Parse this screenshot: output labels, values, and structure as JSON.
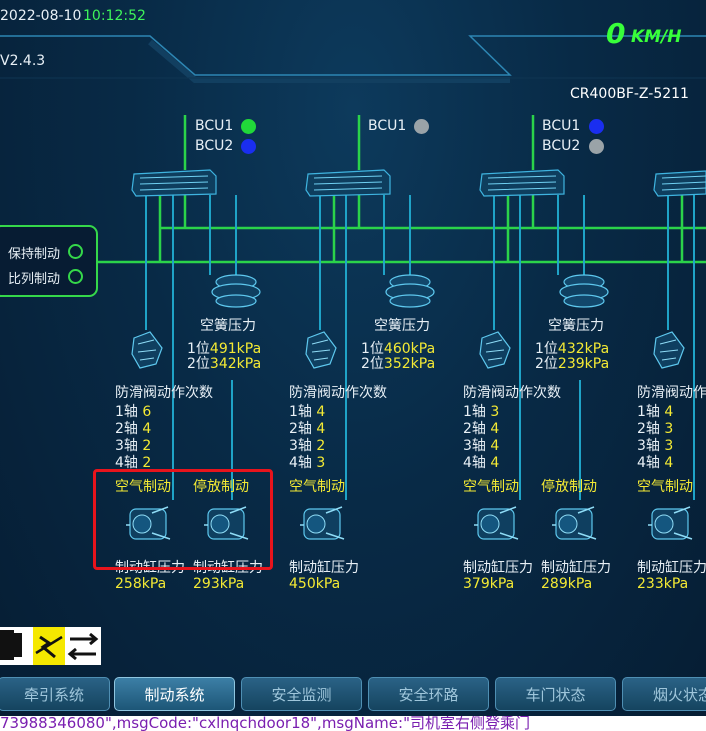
{
  "header": {
    "date": "2022-08-10",
    "time": "10:12:52",
    "version": "V2.4.3",
    "speed": "0",
    "speed_unit": "KM/H",
    "train_id": "CR400BF-Z-5211"
  },
  "hold_panel": {
    "items": [
      {
        "label": "保持制动"
      },
      {
        "label": "比列制动"
      }
    ]
  },
  "cars": [
    {
      "bcu": [
        {
          "label": "BCU1",
          "color": "#21d83a"
        },
        {
          "label": "BCU2",
          "color": "#1a2ef0"
        }
      ],
      "air_spring": {
        "title": "空簧压力",
        "p1_label": "1位",
        "p1": "491kPa",
        "p2_label": "2位",
        "p2": "342kPa"
      },
      "antiskid": {
        "title": "防滑阀动作次数",
        "axles": [
          {
            "label": "1轴",
            "val": "6"
          },
          {
            "label": "2轴",
            "val": "4"
          },
          {
            "label": "3轴",
            "val": "2"
          },
          {
            "label": "4轴",
            "val": "2"
          }
        ]
      },
      "brakes": [
        {
          "label": "空气制动",
          "cyl_label": "制动缸压力",
          "cyl": "258kPa"
        },
        {
          "label": "停放制动",
          "cyl_label": "制动缸压力",
          "cyl": "293kPa"
        }
      ]
    },
    {
      "bcu": [
        {
          "label": "BCU1",
          "color": "#9aa3a8"
        }
      ],
      "air_spring": {
        "title": "空簧压力",
        "p1_label": "1位",
        "p1": "460kPa",
        "p2_label": "2位",
        "p2": "352kPa"
      },
      "antiskid": {
        "title": "防滑阀动作次数",
        "axles": [
          {
            "label": "1轴",
            "val": "4"
          },
          {
            "label": "2轴",
            "val": "4"
          },
          {
            "label": "3轴",
            "val": "2"
          },
          {
            "label": "4轴",
            "val": "3"
          }
        ]
      },
      "brakes": [
        {
          "label": "空气制动",
          "cyl_label": "制动缸压力",
          "cyl": "450kPa"
        }
      ]
    },
    {
      "bcu": [
        {
          "label": "BCU1",
          "color": "#1a2ef0"
        },
        {
          "label": "BCU2",
          "color": "#9aa3a8"
        }
      ],
      "air_spring": {
        "title": "空簧压力",
        "p1_label": "1位",
        "p1": "432kPa",
        "p2_label": "2位",
        "p2": "239kPa"
      },
      "antiskid": {
        "title": "防滑阀动作次数",
        "axles": [
          {
            "label": "1轴",
            "val": "3"
          },
          {
            "label": "2轴",
            "val": "4"
          },
          {
            "label": "3轴",
            "val": "4"
          },
          {
            "label": "4轴",
            "val": "4"
          }
        ]
      },
      "brakes": [
        {
          "label": "空气制动",
          "cyl_label": "制动缸压力",
          "cyl": "379kPa"
        },
        {
          "label": "停放制动",
          "cyl_label": "制动缸压力",
          "cyl": "289kPa"
        }
      ]
    },
    {
      "antiskid": {
        "title": "防滑阀动作次数",
        "axles": [
          {
            "label": "1轴",
            "val": "4"
          },
          {
            "label": "2轴",
            "val": "3"
          },
          {
            "label": "3轴",
            "val": "3"
          },
          {
            "label": "4轴",
            "val": "4"
          }
        ]
      },
      "brakes": [
        {
          "label": "空气制动",
          "cyl_label": "制动缸压力",
          "cyl": "233kPa"
        }
      ]
    }
  ],
  "nav": [
    {
      "label": "牵引系统"
    },
    {
      "label": "制动系统"
    },
    {
      "label": "安全监测"
    },
    {
      "label": "安全环路"
    },
    {
      "label": "车门状态"
    },
    {
      "label": "烟火状态"
    }
  ],
  "icons": [
    "battery-icon",
    "pantograph-icon",
    "direction-arrows-icon"
  ],
  "ticker": {
    "text": "73988346080\",msgCode:\"cxlnqchdoor18\",msgName:\"司机室右侧登乘门"
  },
  "colors": {
    "green": "#35d84a",
    "yellow": "#f4ea34",
    "highlight": "#e8141c",
    "pipe": "#1fa3c7"
  }
}
